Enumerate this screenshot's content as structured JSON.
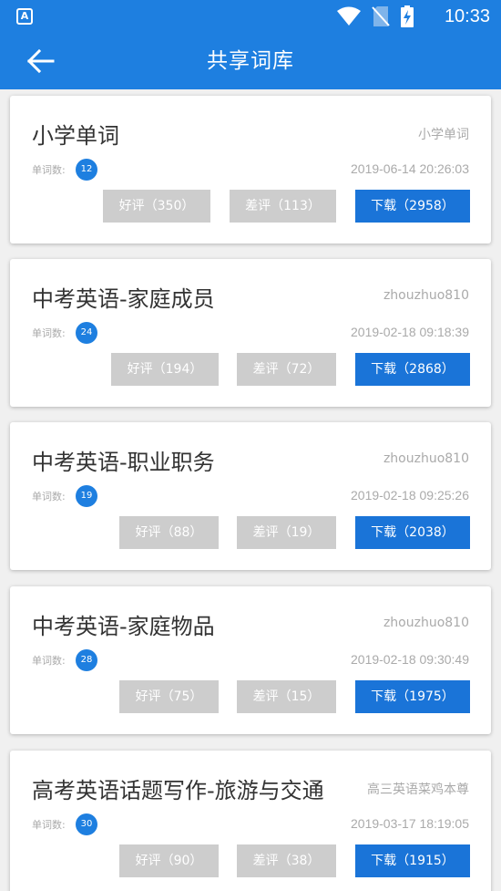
{
  "status_bar": {
    "time": "10:33",
    "app_badge": "A"
  },
  "app_bar": {
    "title": "共享词库"
  },
  "word_count_label": "单词数:",
  "colors": {
    "primary": "#1e7fe0",
    "download": "#1a74d8",
    "gray_button": "#cdcdcd"
  },
  "libraries": [
    {
      "name": "小学单词",
      "author": "小学单词",
      "word_count": "12",
      "date": "2019-06-14 20:26:03",
      "good": "好评（350）",
      "bad": "差评（113）",
      "download": "下载（2958）"
    },
    {
      "name": "中考英语-家庭成员",
      "author": "zhouzhuo810",
      "word_count": "24",
      "date": "2019-02-18 09:18:39",
      "good": "好评（194）",
      "bad": "差评（72）",
      "download": "下载（2868）"
    },
    {
      "name": "中考英语-职业职务",
      "author": "zhouzhuo810",
      "word_count": "19",
      "date": "2019-02-18 09:25:26",
      "good": "好评（88）",
      "bad": "差评（19）",
      "download": "下载（2038）"
    },
    {
      "name": "中考英语-家庭物品",
      "author": "zhouzhuo810",
      "word_count": "28",
      "date": "2019-02-18 09:30:49",
      "good": "好评（75）",
      "bad": "差评（15）",
      "download": "下载（1975）"
    },
    {
      "name": "高考英语话题写作-旅游与交通",
      "author": "高三英语菜鸡本尊",
      "word_count": "30",
      "date": "2019-03-17 18:19:05",
      "good": "好评（90）",
      "bad": "差评（38）",
      "download": "下载（1915）"
    }
  ]
}
